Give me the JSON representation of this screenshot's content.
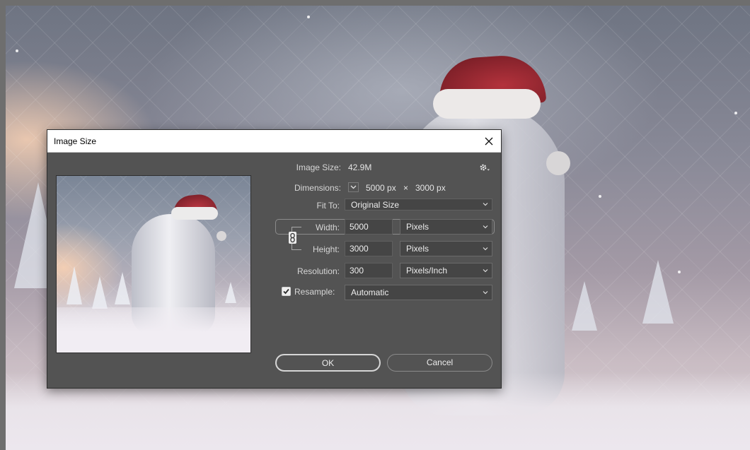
{
  "dialog": {
    "title": "Image Size"
  },
  "image_size": {
    "label": "Image Size:",
    "value": "42.9M"
  },
  "dimensions": {
    "label": "Dimensions:",
    "width": "5000 px",
    "separator": "×",
    "height": "3000 px"
  },
  "fit_to": {
    "label": "Fit To:",
    "value": "Original Size"
  },
  "width": {
    "label": "Width:",
    "value": "5000",
    "unit": "Pixels"
  },
  "height": {
    "label": "Height:",
    "value": "3000",
    "unit": "Pixels"
  },
  "resolution": {
    "label": "Resolution:",
    "value": "300",
    "unit": "Pixels/Inch"
  },
  "resample": {
    "label": "Resample:",
    "checked": true,
    "value": "Automatic"
  },
  "buttons": {
    "ok": "OK",
    "cancel": "Cancel"
  },
  "icons": {
    "close": "close-icon",
    "settings": "gear-icon",
    "link": "chain-link-icon",
    "checkmark": "checkmark-icon",
    "dropdown": "chevron-down-icon"
  }
}
